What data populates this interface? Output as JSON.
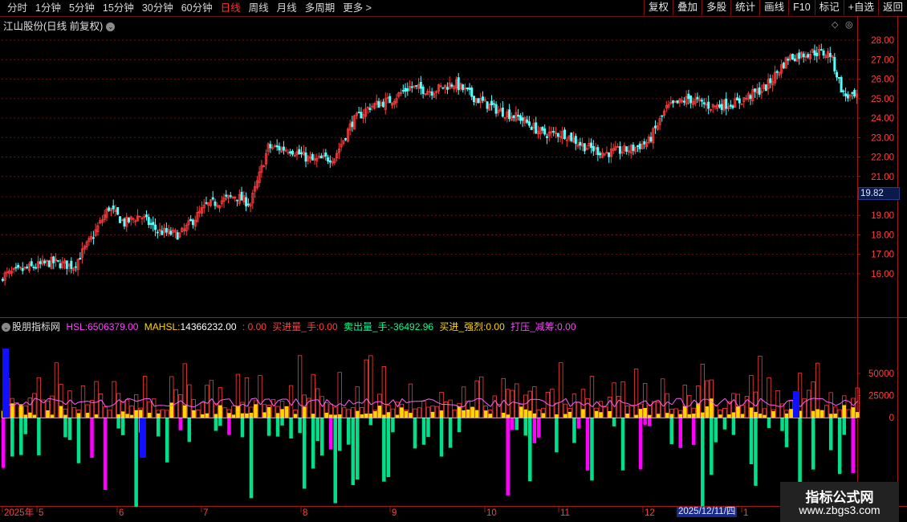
{
  "toolbar": {
    "periods": [
      "分时",
      "1分钟",
      "5分钟",
      "15分钟",
      "30分钟",
      "60分钟",
      "日线",
      "周线",
      "月线",
      "多周期",
      "更多 >"
    ],
    "active_period": "日线",
    "actions": [
      "复权",
      "叠加",
      "多股",
      "统计",
      "画线",
      "F10",
      "标记",
      "+自选",
      "返回"
    ]
  },
  "main_chart": {
    "title": "江山股份(日线 前复权)",
    "current_price": "19.82",
    "y_ticks": [
      "28.00",
      "27.00",
      "26.00",
      "25.00",
      "24.00",
      "23.00",
      "22.00",
      "21.00",
      "19.00",
      "18.00",
      "17.00",
      "16.00"
    ],
    "y_range": [
      14.8,
      28.5
    ]
  },
  "indicator": {
    "name": "股朋指标网",
    "hsl_label": "HSL:",
    "hsl_value": "6506379.00",
    "mahsl_label": "MAHSL:",
    "mahsl_value": "14366232.00",
    "extra_value": ": 0.00",
    "buy_label": "买进量_手:",
    "buy_value": "0.00",
    "sell_label": "卖出量_手:",
    "sell_value": "-36492.96",
    "strong_label": "买进_强烈:",
    "strong_value": "0.00",
    "press_label": "打压_减筹:",
    "press_value": "0.00",
    "y_ticks": [
      "50000",
      "25000",
      "0"
    ]
  },
  "x_axis": {
    "labels": [
      "2025年",
      "5",
      "6",
      "7",
      "8",
      "9",
      "10",
      "11",
      "12",
      "1"
    ],
    "selected_date": "2025/12/11/四"
  },
  "colors": {
    "up": "#ff3c3c",
    "down": "#54ffff",
    "grid": "#6a1010",
    "yellow": "#ffd600",
    "green": "#00e08a",
    "magenta": "#ff00ff",
    "blue": "#1010ff"
  },
  "watermark": {
    "line1": "指标公式网",
    "line2": "www.zbgs3.com"
  }
}
